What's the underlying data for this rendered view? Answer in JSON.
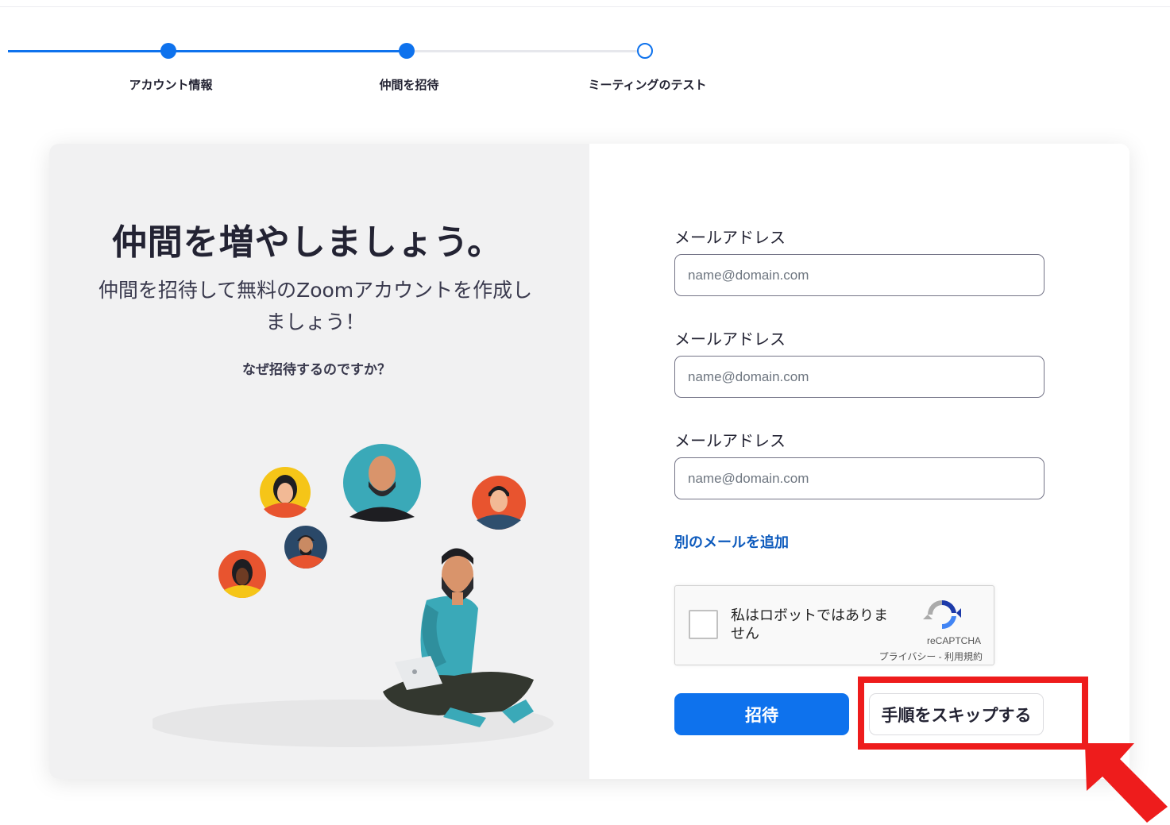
{
  "stepper": {
    "steps": [
      {
        "label": "アカウント情報",
        "state": "done"
      },
      {
        "label": "仲間を招待",
        "state": "current"
      },
      {
        "label": "ミーティングのテスト",
        "state": "pending"
      }
    ]
  },
  "intro": {
    "headline": "仲間を増やしましょう。",
    "subtext": "仲間を招待して無料のZoomアカウントを作成しましょう！",
    "why_link": "なぜ招待するのですか？"
  },
  "form": {
    "fields": [
      {
        "label": "メールアドレス",
        "placeholder": "name@domain.com",
        "value": ""
      },
      {
        "label": "メールアドレス",
        "placeholder": "name@domain.com",
        "value": ""
      },
      {
        "label": "メールアドレス",
        "placeholder": "name@domain.com",
        "value": ""
      }
    ],
    "add_email_link": "別のメールを追加",
    "recaptcha": {
      "label": "私はロボットではありません",
      "brand": "reCAPTCHA",
      "terms": "プライバシー - 利用規約",
      "checked": false
    },
    "invite_button": "招待",
    "skip_button": "手順をスキップする"
  },
  "colors": {
    "accent": "#0e72ed",
    "highlight": "#ee1c1c",
    "link": "#0e5bbd"
  }
}
